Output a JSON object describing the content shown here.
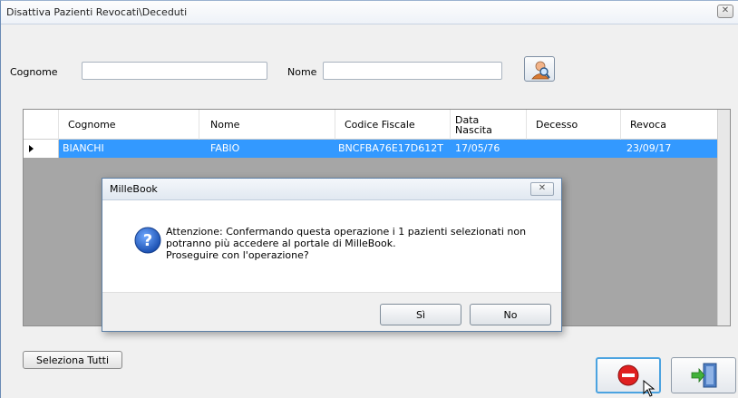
{
  "window": {
    "title": "Disattiva Pazienti Revocati\\Deceduti",
    "close_glyph": "✕"
  },
  "filters": {
    "cognome_label": "Cognome",
    "cognome_value": "",
    "nome_label": "Nome",
    "nome_value": "",
    "search_icon": "user-search-icon"
  },
  "grid": {
    "columns": [
      "Cognome",
      "Nome",
      "Codice Fiscale",
      "Data\nNascita",
      "Decesso",
      "Revoca"
    ],
    "rows": [
      {
        "cognome": "BIANCHI",
        "nome": "FABIO",
        "codice_fiscale": "BNCFBA76E17D612T",
        "data_nascita": "17/05/76",
        "decesso": "",
        "revoca": "23/09/17"
      }
    ],
    "selected_color": "#3399ff"
  },
  "dialog": {
    "title": "MilleBook",
    "close_glyph": "✕",
    "icon": "question-icon",
    "message_lines": [
      "Attenzione: Confermando questa operazione i 1 pazienti selezionati non",
      "potranno più accedere al portale di MilleBook.",
      "Proseguire con l'operazione?"
    ],
    "yes_label": "Sì",
    "no_label": "No"
  },
  "footer": {
    "select_all_label": "Seleziona Tutti",
    "deactivate_icon": "no-entry-icon",
    "exit_icon": "exit-door-icon"
  }
}
